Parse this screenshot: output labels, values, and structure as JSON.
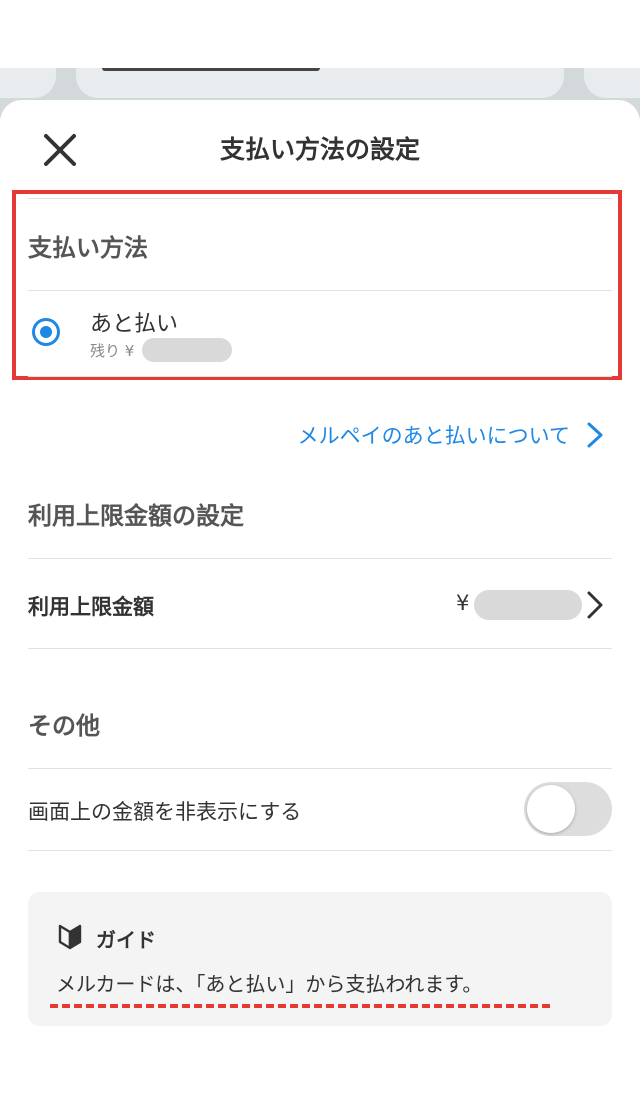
{
  "sheet": {
    "title": "支払い方法の設定"
  },
  "payment_method": {
    "section_title": "支払い方法",
    "selected_option": "あと払い",
    "remaining_prefix": "残り ¥",
    "about_link": "メルペイのあと払いについて"
  },
  "limit": {
    "section_title": "利用上限金額の設定",
    "row_label": "利用上限金額",
    "currency": "¥"
  },
  "other": {
    "section_title": "その他",
    "hide_amount_label": "画面上の金額を非表示にする",
    "hide_amount_enabled": false
  },
  "guide": {
    "title": "ガイド",
    "text": "メルカードは、「あと払い」から支払われます。"
  },
  "colors": {
    "accent": "#1e88e5",
    "highlight": "#e53935"
  },
  "icons": {
    "close": "close-icon",
    "chevron": "chevron-right-icon",
    "guide": "beginner-mark-icon"
  }
}
